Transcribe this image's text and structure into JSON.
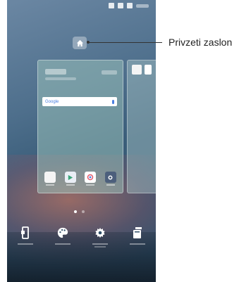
{
  "callout": {
    "label": "Privzeti zaslon"
  },
  "search": {
    "brand": "Google"
  },
  "page_indicator": {
    "count": 2,
    "active": 1
  },
  "icons": {
    "status": [
      "nfc-icon",
      "signal-icon",
      "battery-icon"
    ],
    "home": "home-icon",
    "bottom": [
      "widgets-icon",
      "themes-icon",
      "settings-icon",
      "apps-icon"
    ]
  }
}
